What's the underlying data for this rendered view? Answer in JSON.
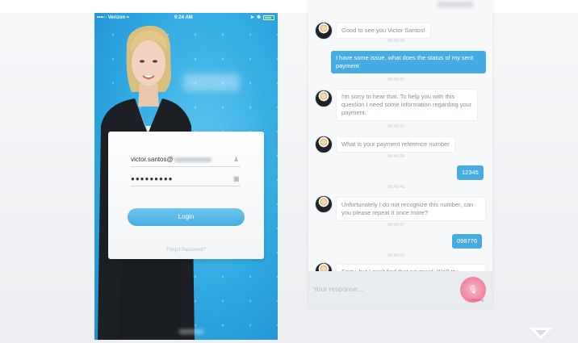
{
  "login_screen": {
    "status_bar": {
      "carrier": "••••○ Verizon ≈",
      "time": "9:24 AM"
    },
    "email_value": "victor.santos@",
    "password_value": "●●●●●●●●●",
    "login_label": "Login",
    "forgot_label": "Forgot Password?"
  },
  "chat": {
    "messages": [
      {
        "from": "bot",
        "text": "Good to see you Victor Santos!",
        "time": "08:48:36"
      },
      {
        "from": "user",
        "text": "I have some issue, what does the status of my sent payment",
        "time": "08:48:37"
      },
      {
        "from": "bot",
        "text": "I'm sorry to hear that. To help you with this question I need some information regarding your payment.",
        "time": "08:48:37"
      },
      {
        "from": "bot",
        "text": "What is your payment reference number",
        "time": "08:48:39"
      },
      {
        "from": "user",
        "text": "12345",
        "time": "08:48:43"
      },
      {
        "from": "bot",
        "text": "Unfortunately I do not recognize this number, can you please repeat it once more?",
        "time": "08:48:47"
      },
      {
        "from": "user",
        "text": "098776",
        "time": "08:48:52"
      },
      {
        "from": "bot",
        "text": "Sorry, but I can't find that payment. We'll try",
        "time": ""
      }
    ],
    "input_placeholder": "Your response...",
    "mic_label": "Listening"
  },
  "colors": {
    "accent_blue": "#47abe3",
    "mic_pink": "#ee6f92"
  }
}
